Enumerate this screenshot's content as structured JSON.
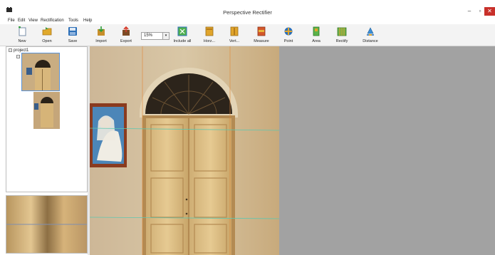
{
  "window": {
    "title": "Perspective Rectifier",
    "controls": {
      "minimize": "–",
      "maximize": "▫",
      "close": "✕"
    }
  },
  "menu": [
    {
      "label": "File"
    },
    {
      "label": "Edit"
    },
    {
      "label": "View"
    },
    {
      "label": "Rectification"
    },
    {
      "label": "Tools"
    },
    {
      "label": "Help"
    }
  ],
  "toolbar": {
    "new": "New",
    "open": "Open",
    "save": "Save",
    "import": "Import",
    "export": "Export",
    "zoom_value": "15%",
    "include_all": "Include all",
    "horz": "Horz...",
    "vert": "Vert...",
    "measure": "Measure",
    "point": "Point",
    "area": "Area",
    "rectify": "Rectify",
    "distance": "Distance"
  },
  "tree": {
    "root_label": "project1",
    "expander": "⊟"
  },
  "colors": {
    "accent_blue": "#5a93d8",
    "guide_orange": "#e08a3c",
    "guide_teal": "#5fc7b0",
    "close_red": "#c8302a",
    "canvas_gray": "#a2a2a2"
  }
}
